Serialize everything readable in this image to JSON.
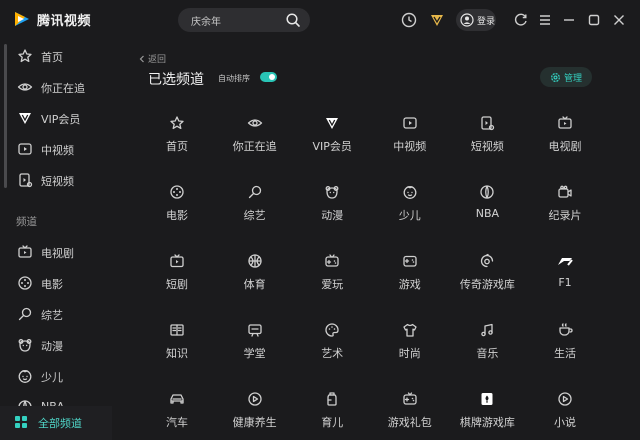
{
  "app": {
    "title": "腾讯视频"
  },
  "search": {
    "value": "庆余年"
  },
  "header": {
    "login_label": "登录"
  },
  "sidebar": {
    "top_items": [
      {
        "label": "首页",
        "icon": "star-icon"
      },
      {
        "label": "你正在追",
        "icon": "eye-icon"
      },
      {
        "label": "VIP会员",
        "icon": "vip-icon"
      },
      {
        "label": "中视频",
        "icon": "play-box-icon"
      },
      {
        "label": "短视频",
        "icon": "short-video-icon"
      }
    ],
    "section_label": "频道",
    "channel_items": [
      {
        "label": "电视剧",
        "icon": "tv-icon"
      },
      {
        "label": "电影",
        "icon": "film-reel-icon"
      },
      {
        "label": "综艺",
        "icon": "microphone-icon"
      },
      {
        "label": "动漫",
        "icon": "bear-icon"
      },
      {
        "label": "少儿",
        "icon": "child-face-icon"
      },
      {
        "label": "NBA",
        "icon": "basketball-icon"
      }
    ],
    "all_channels_label": "全部频道"
  },
  "main": {
    "back_label": "返回",
    "title": "已选频道",
    "auto_sort_label": "自动排序",
    "auto_sort_on": true,
    "manage_label": "管理",
    "accent_color": "#29c4b6",
    "channels": [
      {
        "label": "首页",
        "icon": "star-icon"
      },
      {
        "label": "你正在追",
        "icon": "eye-icon"
      },
      {
        "label": "VIP会员",
        "icon": "vip-icon"
      },
      {
        "label": "中视频",
        "icon": "play-box-icon"
      },
      {
        "label": "短视频",
        "icon": "short-video-icon"
      },
      {
        "label": "电视剧",
        "icon": "tv-icon"
      },
      {
        "label": "电影",
        "icon": "film-reel-icon"
      },
      {
        "label": "综艺",
        "icon": "microphone-icon"
      },
      {
        "label": "动漫",
        "icon": "bear-icon"
      },
      {
        "label": "少儿",
        "icon": "child-face-icon"
      },
      {
        "label": "NBA",
        "icon": "basketball-icon"
      },
      {
        "label": "纪录片",
        "icon": "camera-icon"
      },
      {
        "label": "短剧",
        "icon": "tv-play-icon"
      },
      {
        "label": "体育",
        "icon": "ball-icon"
      },
      {
        "label": "爱玩",
        "icon": "gamepad-icon"
      },
      {
        "label": "游戏",
        "icon": "game-controller-icon"
      },
      {
        "label": "传奇游戏库",
        "icon": "swirl-icon"
      },
      {
        "label": "F1",
        "icon": "f1-icon"
      },
      {
        "label": "知识",
        "icon": "book-icon"
      },
      {
        "label": "学堂",
        "icon": "classroom-icon"
      },
      {
        "label": "艺术",
        "icon": "palette-icon"
      },
      {
        "label": "时尚",
        "icon": "shirt-icon"
      },
      {
        "label": "音乐",
        "icon": "music-note-icon"
      },
      {
        "label": "生活",
        "icon": "cup-icon"
      },
      {
        "label": "汽车",
        "icon": "car-icon"
      },
      {
        "label": "健康养生",
        "icon": "health-play-icon"
      },
      {
        "label": "育儿",
        "icon": "baby-bottle-icon"
      },
      {
        "label": "游戏礼包",
        "icon": "gift-controller-icon"
      },
      {
        "label": "棋牌游戏库",
        "icon": "card-icon"
      },
      {
        "label": "小说",
        "icon": "novel-play-icon"
      }
    ]
  }
}
